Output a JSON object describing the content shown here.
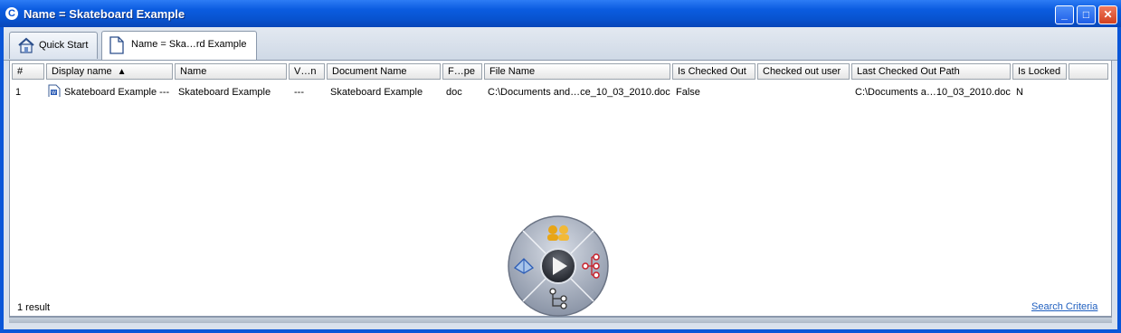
{
  "window": {
    "title": "Name = Skateboard Example",
    "app_icon": "app-logo-icon",
    "controls": {
      "minimize_icon": "minimize-icon",
      "maximize_icon": "maximize-icon",
      "close_icon": "close-icon"
    }
  },
  "tabs": [
    {
      "label": "Quick Start",
      "icon": "home-icon"
    },
    {
      "label": "Name = Ska…rd Example",
      "icon": "document-icon"
    }
  ],
  "table": {
    "sorted_column": "Display name",
    "sort_direction": "ascending",
    "columns": [
      "#",
      "Display name",
      "Name",
      "V…n",
      "Document Name",
      "F…pe",
      "File Name",
      "Is Checked Out",
      "Checked out user",
      "Last Checked Out Path",
      "Is Locked",
      ""
    ],
    "rows": [
      {
        "num": "1",
        "display_name": "Skateboard Example ---",
        "name": "Skateboard Example",
        "version": "---",
        "document_name": "Skateboard Example",
        "file_type": "doc",
        "file_name": "C:\\Documents and…ce_10_03_2010.doc",
        "is_checked_out": "False",
        "checked_out_user": "",
        "last_checked_out_path": "C:\\Documents a…10_03_2010.doc",
        "is_locked": "N"
      }
    ]
  },
  "footer": {
    "result_count": "1 result",
    "search_criteria_link": "Search Criteria"
  },
  "radial_menu": {
    "center_icon": "play-icon",
    "segments": [
      "people-icon",
      "hierarchy-icon",
      "tree-icon",
      "model-icon"
    ]
  }
}
